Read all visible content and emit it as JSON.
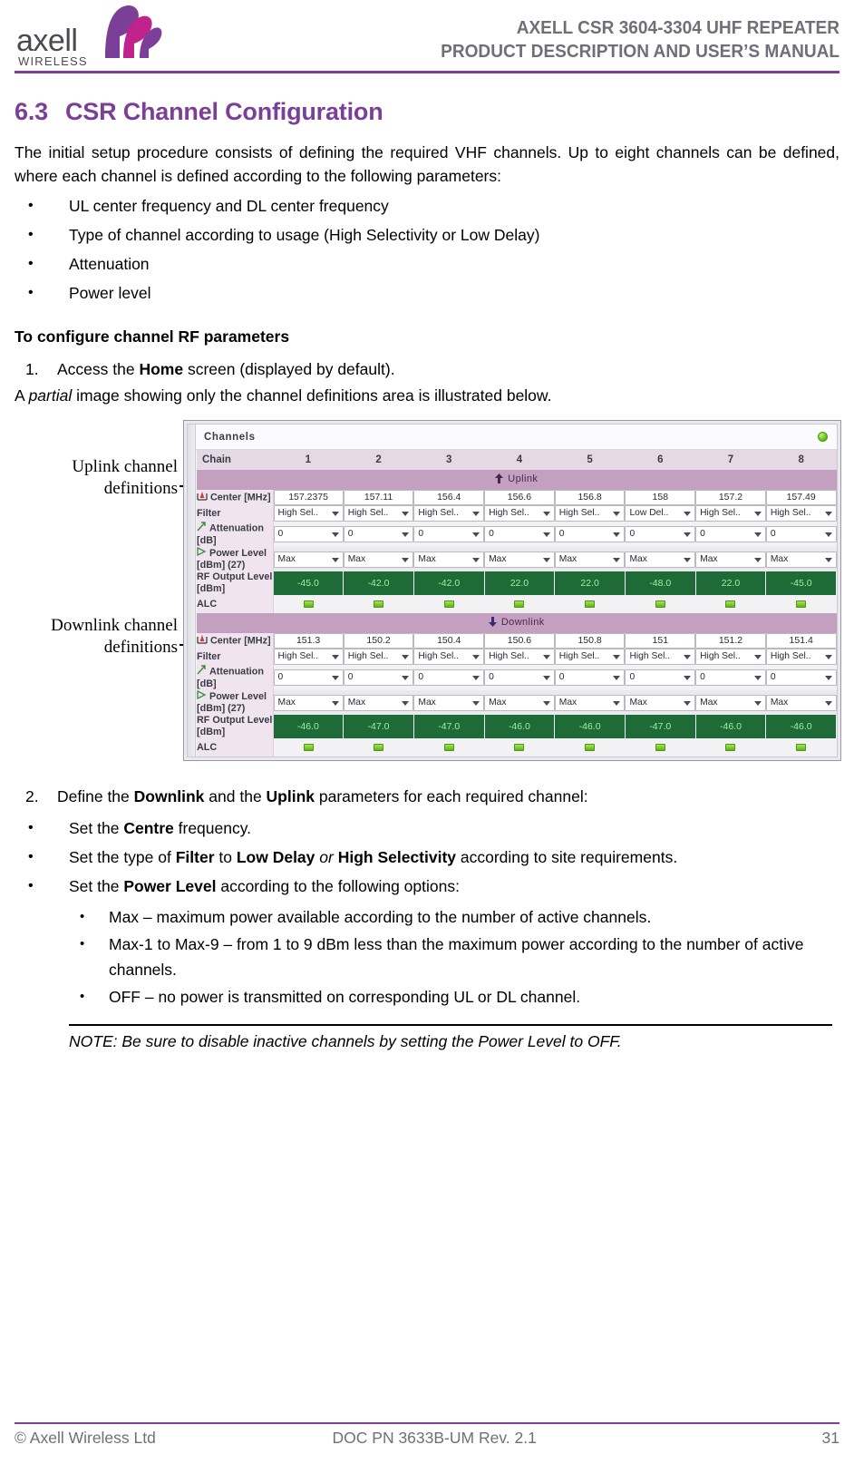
{
  "header": {
    "logo_text": "axell",
    "logo_sub": "WIRELESS",
    "title_line1": "AXELL CSR 3604-3304 UHF REPEATER",
    "title_line2": "PRODUCT DESCRIPTION AND USER’S MANUAL",
    "accent_color": "#7b3f98"
  },
  "section": {
    "number": "6.3",
    "title": "CSR Channel Configuration",
    "intro": "The initial setup procedure consists of defining the required VHF channels. Up to eight channels can be defined, where each channel is defined according to the following parameters:",
    "param_bullets": [
      "UL center frequency and DL center frequency",
      "Type of channel according to usage (High Selectivity or Low Delay)",
      "Attenuation",
      "Power level"
    ],
    "configure_heading": "To configure channel RF parameters",
    "step1_num": "1.",
    "step1_text_a": "Access the ",
    "step1_bold": "Home",
    "step1_text_b": " screen (displayed by default).",
    "partial_a": "A ",
    "partial_italic": "partial",
    "partial_b": " image showing only the channel definitions area is illustrated below."
  },
  "figure": {
    "callout_uplink": "Uplink channel definitions",
    "callout_downlink": "Downlink channel definitions"
  },
  "screenshot": {
    "panel_title": "Channels",
    "status_indicator": "green-status-led",
    "chain_label": "Chain",
    "chain_numbers": [
      "1",
      "2",
      "3",
      "4",
      "5",
      "6",
      "7",
      "8"
    ],
    "uplink_band_label": "Uplink",
    "downlink_band_label": "Downlink",
    "row_labels": {
      "center": "Center [MHz]",
      "filter": "Filter",
      "attenuation_l1": "Attenuation",
      "attenuation_l2": "[dB]",
      "power_level_l1": "Power Level",
      "power_level_l2": "[dBm] (27)",
      "rf_output_l1": "RF Output Level",
      "rf_output_l2": "[dBm]",
      "alc": "ALC"
    },
    "uplink": {
      "center": [
        "157.2375",
        "157.11",
        "156.4",
        "156.6",
        "156.8",
        "158",
        "157.2",
        "157.49"
      ],
      "filter": [
        "High Sel..",
        "High Sel..",
        "High Sel..",
        "High Sel..",
        "High Sel..",
        "Low Del..",
        "High Sel..",
        "High Sel.."
      ],
      "attenuation": [
        "0",
        "0",
        "0",
        "0",
        "0",
        "0",
        "0",
        "0"
      ],
      "power_level": [
        "Max",
        "Max",
        "Max",
        "Max",
        "Max",
        "Max",
        "Max",
        "Max"
      ],
      "rf_output": [
        "-45.0",
        "-42.0",
        "-42.0",
        "22.0",
        "22.0",
        "-48.0",
        "22.0",
        "-45.0"
      ],
      "alc": [
        "on",
        "on",
        "on",
        "on",
        "on",
        "on",
        "on",
        "on"
      ]
    },
    "downlink": {
      "center": [
        "151.3",
        "150.2",
        "150.4",
        "150.6",
        "150.8",
        "151",
        "151.2",
        "151.4"
      ],
      "filter": [
        "High Sel..",
        "High Sel..",
        "High Sel..",
        "High Sel..",
        "High Sel..",
        "High Sel..",
        "High Sel..",
        "High Sel.."
      ],
      "attenuation": [
        "0",
        "0",
        "0",
        "0",
        "0",
        "0",
        "0",
        "0"
      ],
      "power_level": [
        "Max",
        "Max",
        "Max",
        "Max",
        "Max",
        "Max",
        "Max",
        "Max"
      ],
      "rf_output": [
        "-46.0",
        "-47.0",
        "-47.0",
        "-46.0",
        "-46.0",
        "-47.0",
        "-46.0",
        "-46.0"
      ],
      "alc": [
        "on",
        "on",
        "on",
        "on",
        "on",
        "on",
        "on",
        "on"
      ]
    },
    "colors": {
      "band_bar": "#c4a0c0",
      "chain_bar": "#e6d9e6",
      "row_label_bg": "#efe4ef",
      "rf_cell_bg": "#1e6b38",
      "rf_cell_text": "#9ff29f"
    }
  },
  "instructions": {
    "step2_num": "2.",
    "step2_a": "Define the ",
    "step2_b1": "Downlink",
    "step2_c": " and the ",
    "step2_b2": "Uplink",
    "step2_d": " parameters for each required channel:",
    "b1_a": "Set the ",
    "b1_b": "Centre",
    "b1_c": " frequency.",
    "b2_a": "Set the type of ",
    "b2_b": "Filter",
    "b2_c": " to ",
    "b2_d": "Low Delay",
    "b2_e": " or ",
    "b2_f": "High Selectivity",
    "b2_g": " according to site requirements.",
    "b3_a": "Set the ",
    "b3_b": "Power Level",
    "b3_c": " according to the following options:",
    "sub_bullets": [
      "Max – maximum power available according to the number of active channels.",
      "Max-1 to Max-9 – from 1 to 9 dBm less than the maximum power according to the number of active channels.",
      "OFF – no power is transmitted on corresponding UL or DL channel."
    ],
    "note": "NOTE: Be sure to disable inactive channels by setting the Power Level to OFF."
  },
  "footer": {
    "left": "© Axell Wireless Ltd",
    "center": "DOC PN 3633B-UM Rev. 2.1",
    "right": "31"
  }
}
